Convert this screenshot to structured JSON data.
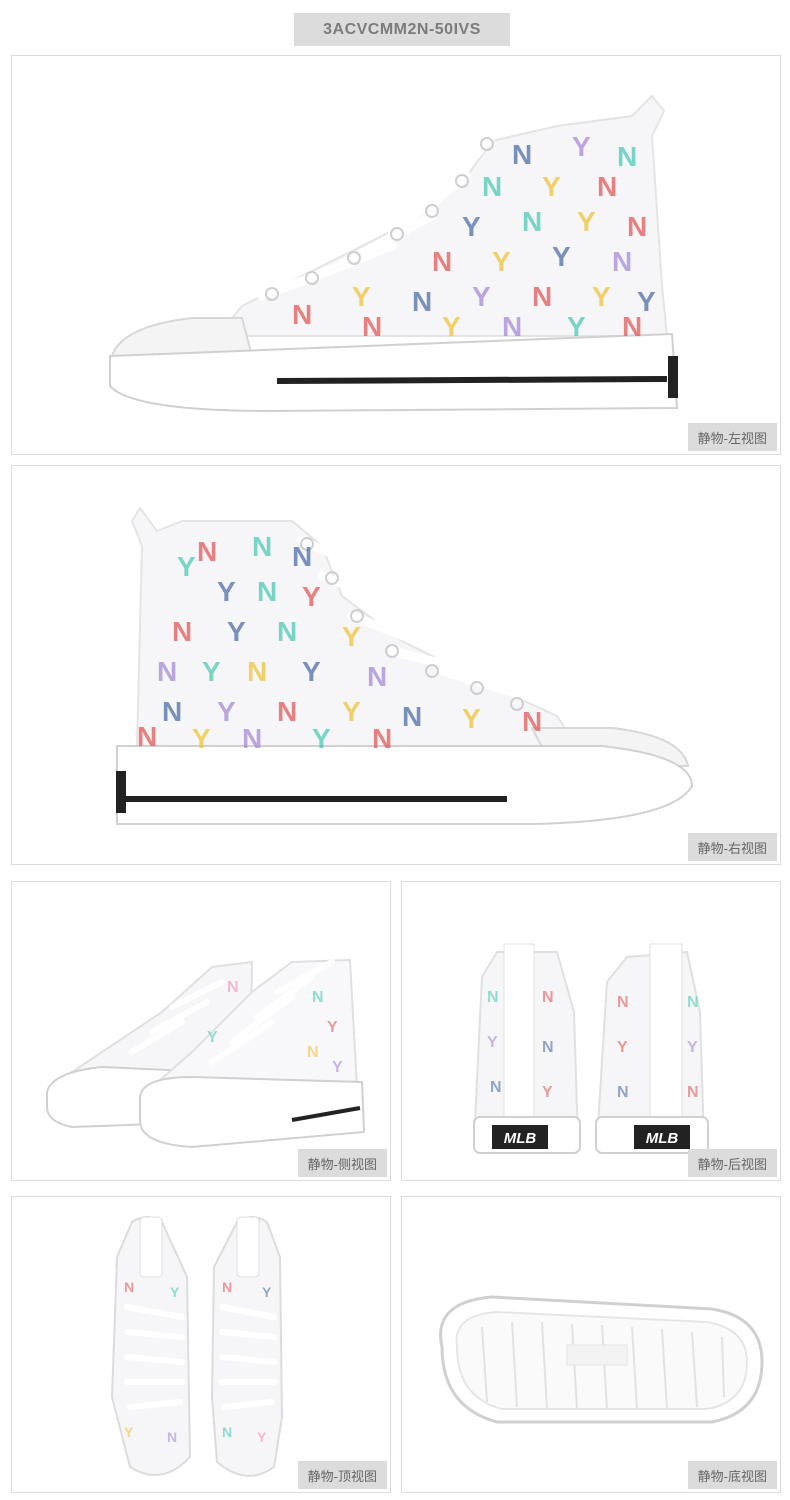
{
  "header": {
    "sku": "3ACVCMM2N-50IVS"
  },
  "views": {
    "left": {
      "label": "静物-左视图"
    },
    "right": {
      "label": "静物-右视图"
    },
    "side": {
      "label": "静物-侧视图"
    },
    "back": {
      "label": "静物-后视图"
    },
    "top": {
      "label": "静物-顶视图"
    },
    "bottom": {
      "label": "静物-底视图"
    }
  },
  "brand": {
    "heel_logo": "MLB"
  },
  "colors": {
    "panel_border": "#dcdcdc",
    "tag_bg": "#dcdcdc",
    "monogram": [
      "#e35a5a",
      "#4f6fa8",
      "#f0c43a",
      "#4fc9b5",
      "#a68ad8",
      "#f08fb0"
    ]
  }
}
